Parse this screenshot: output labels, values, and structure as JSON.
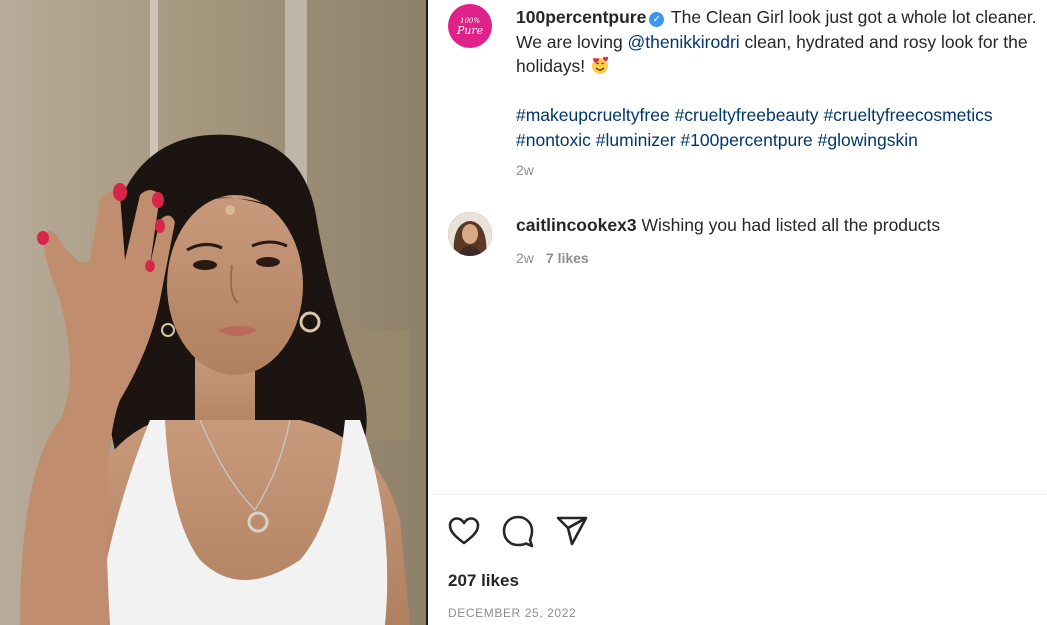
{
  "post": {
    "username": "100percentpure",
    "brand_mark": {
      "top": "100%",
      "bottom": "Pure"
    },
    "caption_part1": "The Clean Girl look just got a whole lot cleaner. We are loving ",
    "mention": "@thenikkirodri",
    "caption_part2": " clean, hydrated and rosy look for the holidays! ",
    "hashtags": [
      "#makeupcrueltyfree",
      "#crueltyfreebeauty",
      "#crueltyfreecosmetics",
      "#nontoxic",
      "#luminizer",
      "#100percentpure",
      "#glowingskin"
    ],
    "time_ago": "2w"
  },
  "comment": {
    "username": "caitlincookex3",
    "text": "Wishing you had listed all the products",
    "time_ago": "2w",
    "likes": "7 likes"
  },
  "actions": {
    "like_icon": "heart-icon",
    "comment_icon": "comment-bubble-icon",
    "share_icon": "paper-plane-icon"
  },
  "likes_count": "207 likes",
  "date": "DECEMBER 25, 2022",
  "colors": {
    "link": "#00376b",
    "muted": "#8e8e8e",
    "brand": "#e0218a",
    "verified": "#3897f0"
  }
}
